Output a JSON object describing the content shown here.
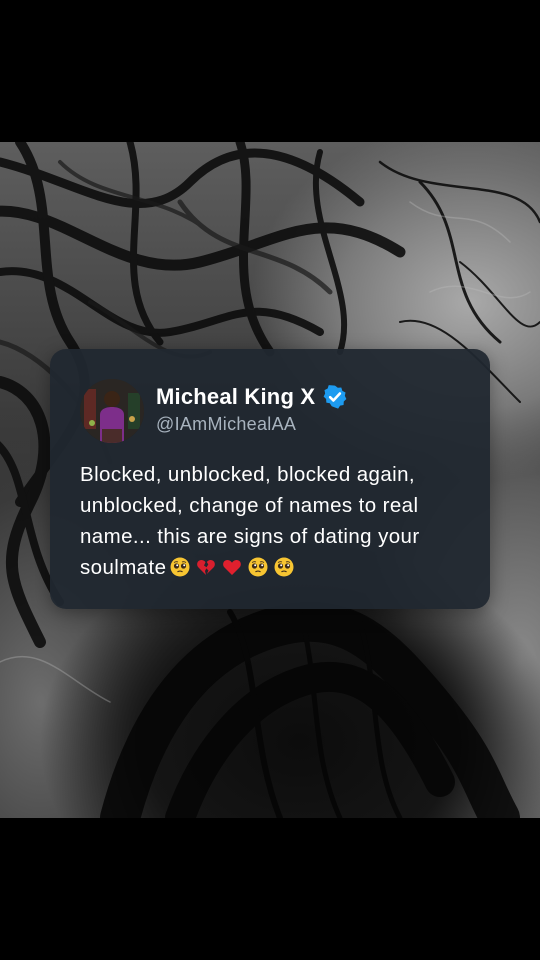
{
  "tweet": {
    "display_name": "Micheal King X",
    "handle": "@IAmMichealAA",
    "text": "Blocked, unblocked, blocked again, unblocked, change of names to real name... this are signs of dating your soulmate",
    "emojis": [
      "pleading-face",
      "broken-heart",
      "red-heart",
      "pleading-face",
      "pleading-face"
    ],
    "verified": true
  },
  "colors": {
    "card_background": "#202730",
    "verified_badge": "#1d9bf0",
    "text_primary": "#ffffff",
    "text_secondary": "#a8b3be"
  }
}
